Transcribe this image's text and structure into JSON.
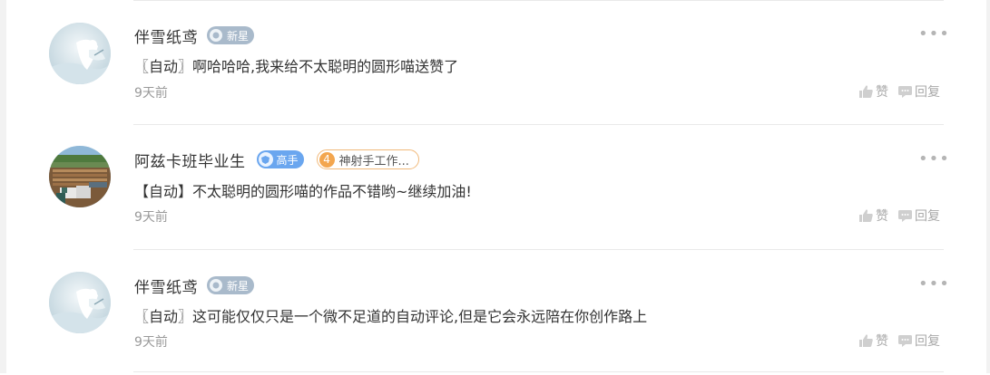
{
  "comments": [
    {
      "username": "伴雪纸鸢",
      "level_badge": "新星",
      "level_type": "xin",
      "text": "〖自动〗啊哈哈哈,我来给不太聪明的圆形喵送赞了",
      "time": "9天前",
      "avatar": "snow-figure"
    },
    {
      "username": "阿兹卡班毕业生",
      "level_badge": "高手",
      "level_type": "gao",
      "medal": {
        "number": "4",
        "label": "神射手工作..."
      },
      "text": "【自动】不太聪明的圆形喵的作品不错哟~继续加油!",
      "time": "9天前",
      "avatar": "minecraft-scene"
    },
    {
      "username": "伴雪纸鸢",
      "level_badge": "新星",
      "level_type": "xin",
      "text": "〖自动〗这可能仅仅只是一个微不足道的自动评论,但是它会永远陪在你创作路上",
      "time": "9天前",
      "avatar": "snow-figure"
    }
  ],
  "actions": {
    "like_label": "赞",
    "reply_label": "回复",
    "more_label": "•••"
  },
  "icons": {
    "like": "thumbs-up-icon",
    "reply": "chat-bubble-icon",
    "more": "more-dots-icon"
  },
  "colors": {
    "badge_xin": "#a9bacb",
    "badge_gao": "#6aa6ef",
    "medal": "#f3a64f",
    "meta": "#9a9a9a"
  }
}
